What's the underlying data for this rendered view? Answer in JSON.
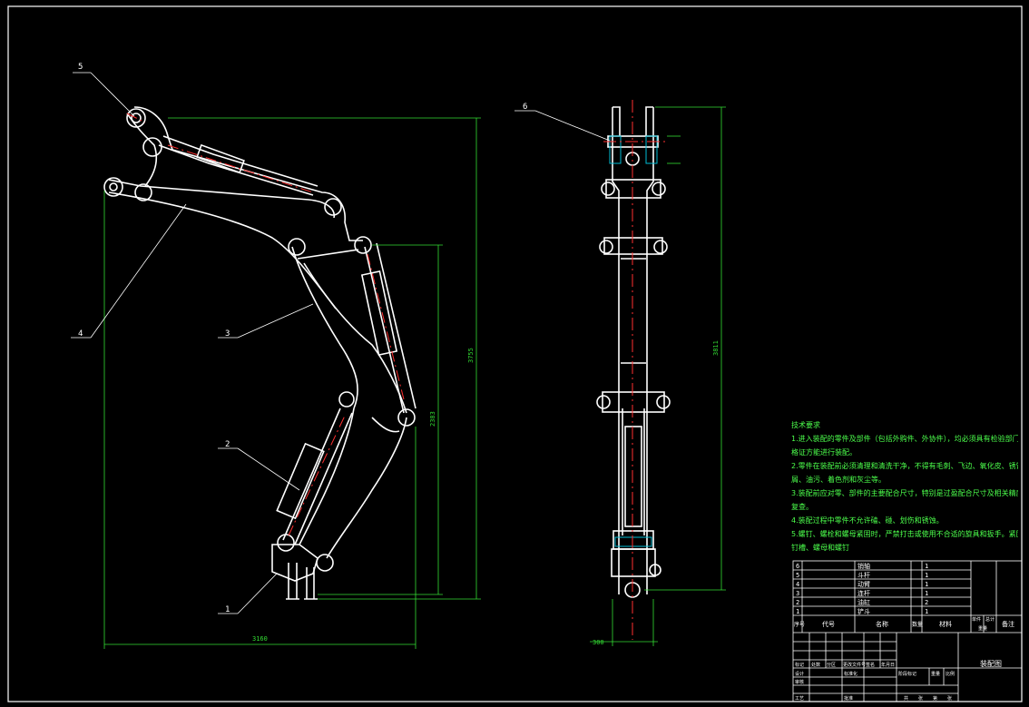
{
  "colors": {
    "background": "#000000",
    "outline": "#ffffff",
    "centerline": "#ff3030",
    "dimension": "#33dd33",
    "hatch": "#00bcd4",
    "note_text": "#4cff4c"
  },
  "balloons": [
    "5",
    "4",
    "3",
    "2",
    "1",
    "6"
  ],
  "dimensions": {
    "overall_width": "3160",
    "overall_height": "3755",
    "lower_height": "2383",
    "side_height": "3811",
    "side_width": "300"
  },
  "technical_notes": {
    "title": "技术要求",
    "items": [
      "1.进入装配的零件及部件（包括外购件、外协件），均必须具有检验部门的合",
      "格证方能进行装配。",
      "2.零件在装配前必须清理和清洗干净，不得有毛刺、飞边、氧化皮、锈蚀、切",
      "屑、油污、着色剂和灰尘等。",
      "3.装配前应对零、部件的主要配合尺寸，特别是过盈配合尺寸及相关精度进行",
      "复查。",
      "4.装配过程中零件不允许磕、碰、划伤和锈蚀。",
      "5.螺钉、螺栓和螺母紧固时，严禁打击或使用不合适的旋具和扳手。紧固后螺",
      "钉槽、螺母和螺钉"
    ]
  },
  "title_block": {
    "bom_rows": [
      {
        "no": "6",
        "name": "销轴",
        "qty": "1"
      },
      {
        "no": "5",
        "name": "斗杆",
        "qty": "1"
      },
      {
        "no": "4",
        "name": "动臂",
        "qty": "1"
      },
      {
        "no": "3",
        "name": "连杆",
        "qty": "1"
      },
      {
        "no": "2",
        "name": "油缸",
        "qty": "2"
      },
      {
        "no": "1",
        "name": "铲斗",
        "qty": "1"
      }
    ],
    "headers": {
      "seq": "序号",
      "code": "代号",
      "name": "名称",
      "qty": "数量",
      "material": "材料",
      "unit_weight": "单件",
      "total_weight": "总计",
      "weight": "重量",
      "remark": "备注"
    },
    "drawing_name": "装配图",
    "revision_labels": [
      "标记",
      "处数",
      "分区",
      "更改文件号",
      "签名",
      "年月日"
    ],
    "sign_labels": [
      "设计",
      "审核",
      "工艺",
      "标准化",
      "批准"
    ],
    "stage_labels": [
      "阶段标记",
      "重量",
      "比例"
    ],
    "sheet_labels": [
      "共",
      "张",
      "第",
      "张"
    ]
  }
}
